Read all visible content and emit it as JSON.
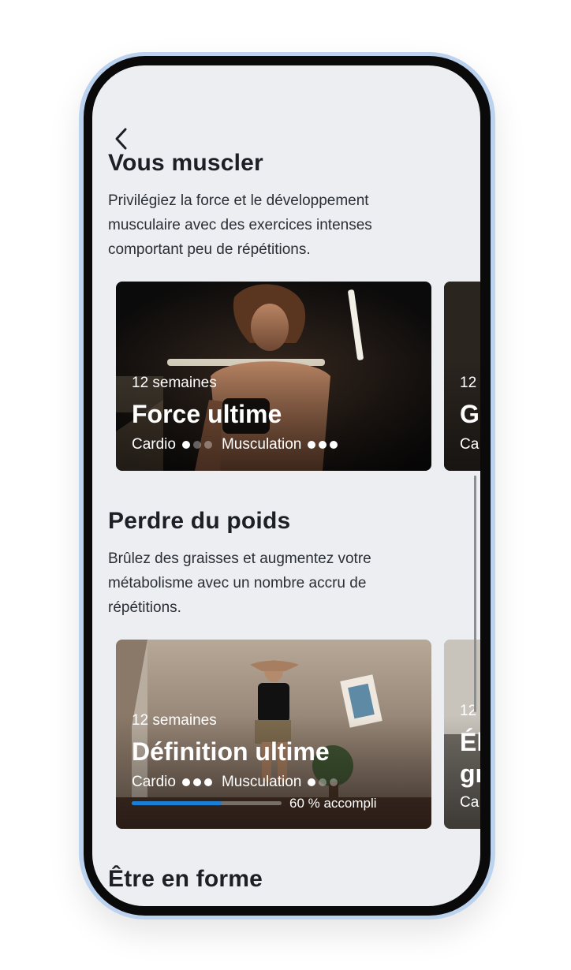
{
  "header": {
    "back_icon": "chevron-left-icon"
  },
  "sections": [
    {
      "title": "Vous muscler",
      "description": "Privilégiez la force et le développement musculaire avec des exercices intenses comportant peu de répétitions.",
      "cards": [
        {
          "duration": "12 semaines",
          "name": "Force ultime",
          "tags": [
            {
              "label": "Cardio",
              "level": 1,
              "max": 3
            },
            {
              "label": "Musculation",
              "level": 3,
              "max": 3
            }
          ]
        },
        {
          "duration": "12",
          "name": "G",
          "tags_text": "Ca"
        }
      ]
    },
    {
      "title": "Perdre du poids",
      "description": "Brûlez des graisses et augmentez votre métabolisme avec un nombre accru de répétitions.",
      "cards": [
        {
          "duration": "12 semaines",
          "name": "Définition ultime",
          "tags": [
            {
              "label": "Cardio",
              "level": 3,
              "max": 3
            },
            {
              "label": "Musculation",
              "level": 1,
              "max": 3
            }
          ],
          "progress": 0.6,
          "progress_label": "60 % accompli"
        },
        {
          "duration": "12",
          "name_line1": "Él",
          "name_line2": "gr",
          "tags_text": "Ca"
        }
      ]
    },
    {
      "title": "Être en forme"
    }
  ],
  "colors": {
    "screen_bg": "#eceef1",
    "accent": "#1c7fd6",
    "frame_outline": "#bcd3ef"
  }
}
